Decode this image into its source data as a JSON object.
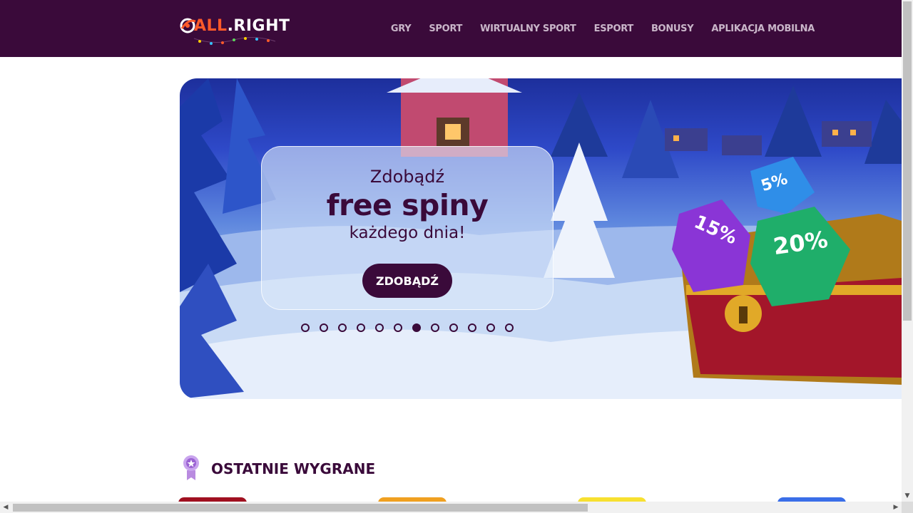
{
  "header": {
    "logo_text_prefix": "ALL",
    "logo_text_suffix": ".RIGHT",
    "nav": [
      "GRY",
      "SPORT",
      "WIRTUALNY SPORT",
      "ESPORT",
      "BONUSY",
      "APLIKACJA MOBILNA"
    ]
  },
  "banner": {
    "line1": "Zdobądź",
    "line2": "free spiny",
    "line3": "każdego dnia!",
    "button_label": "ZDOBĄDŹ",
    "dots_total": 12,
    "active_dot": 6,
    "badges": [
      "5%",
      "15%",
      "20%"
    ]
  },
  "recent_wins": {
    "title": "OSTATNIE WYGRANE"
  },
  "colors": {
    "brand": "#3a0a3a",
    "accent": "#ff5a2a"
  }
}
